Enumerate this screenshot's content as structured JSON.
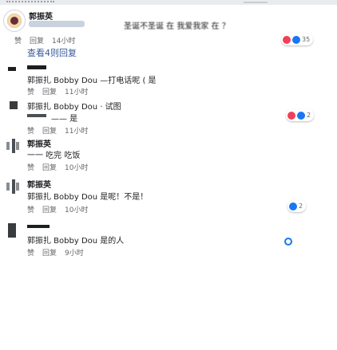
{
  "thread": {
    "main": {
      "author": "郭振英",
      "text_line": "圣诞不圣诞 在 我爱我家 在 ？",
      "meta": [
        "赞",
        "回复",
        "14小时"
      ],
      "reactions": "35",
      "view_replies": "查看4则回复"
    },
    "replies": [
      {
        "author": "——",
        "text": "郭振扎 Bobby Dou —打电话呢 ( 是",
        "meta": [
          "赞",
          "回复",
          "11小时"
        ]
      },
      {
        "author": "郭振扎 Bobby Dou",
        "text": "郭振扎 Bobby Dou · 试图",
        "line2": "—— 是",
        "meta": [
          "赞",
          "回复",
          "11小时"
        ],
        "reactions": "2"
      },
      {
        "author": "郭振英",
        "text": "一一 吃完 吃饭",
        "meta": [
          "赞",
          "回复",
          "10小时"
        ]
      },
      {
        "author": "郭振英",
        "text": "郭振扎 Bobby Dou 是呢！不是！",
        "meta": [
          "赞",
          "回复",
          "10小时"
        ],
        "reactions": "2"
      },
      {
        "author": "——",
        "text": "郭振扎 Bobby Dou 是的人",
        "meta": [
          "赞",
          "回复",
          "9小时"
        ]
      }
    ]
  },
  "colors": {
    "link": "#385898",
    "like": "#1877f2",
    "love": "#f33e58",
    "meta": "#65676b"
  }
}
